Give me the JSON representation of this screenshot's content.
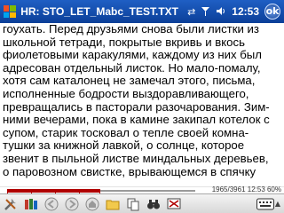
{
  "titlebar": {
    "title": "HR: STO_LET_M",
    "filename": "abc_TEST.TXT",
    "clock": "12:53",
    "ok_label": "ok"
  },
  "reader": {
    "lines": [
      "гоухать. Перед друзьями снова были листки из",
      "школьной тетради, покрытые вкривь и вкось",
      "фиолетовыми каракулями, каждому из них был",
      "адресован отдельный листок. Но мало-помалу,",
      "хотя сам каталонец не замечал этого, письма,",
      "исполненные бодрости выздоравливающего,",
      "превращались в пасторали разочарования. Зим-",
      "ними вечерами, пока в камине закипал котелок с",
      "супом, старик тосковал о тепле своей комна-",
      "тушки за книжной лавкой, о солнце, которое",
      "звенит в пыльной листве миндальных деревьев,",
      "о паровозном свистке, врывающемся в спячку"
    ]
  },
  "status": {
    "position_text": "1965/3961 12:53 60%",
    "progress": 0.496
  },
  "toolbar": {
    "items": [
      "tools",
      "library",
      "back",
      "forward",
      "home",
      "open",
      "copy",
      "find",
      "fullscreen",
      "keyboard"
    ]
  },
  "colors": {
    "titlebar": "#0b3f98",
    "progress": "#b00000",
    "toolbar": "#d8d8d8"
  }
}
